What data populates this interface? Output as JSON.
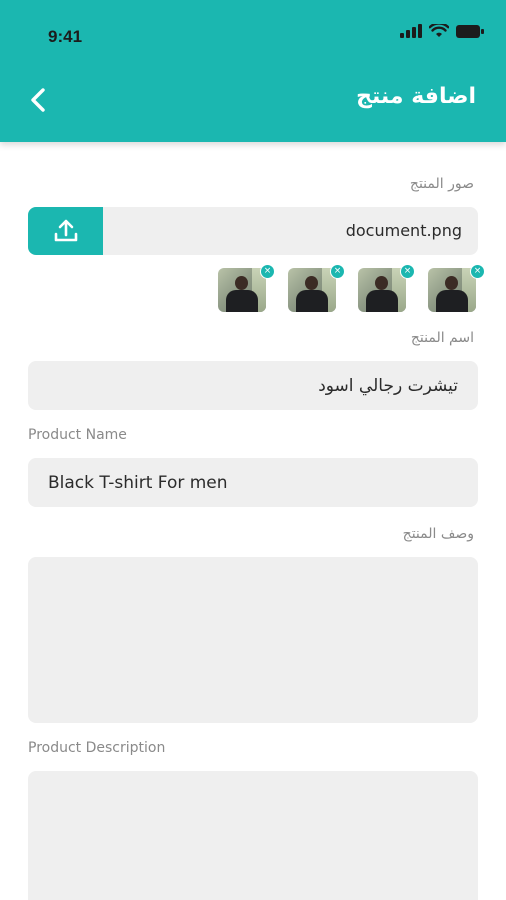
{
  "status_bar": {
    "time": "9:41"
  },
  "header": {
    "title": "اضافة منتج"
  },
  "images_section": {
    "label": "صور المنتج",
    "file_name": "document.png",
    "thumbnails": [
      {
        "remove_symbol": "×"
      },
      {
        "remove_symbol": "×"
      },
      {
        "remove_symbol": "×"
      },
      {
        "remove_symbol": "×"
      }
    ]
  },
  "name_ar": {
    "label": "اسم المنتج",
    "value": "تيشرت رجالي اسود"
  },
  "name_en": {
    "label": "Product Name",
    "value": "Black T-shirt For men"
  },
  "desc_ar": {
    "label": "وصف المنتج",
    "value": ""
  },
  "desc_en": {
    "label": "Product Description",
    "value": ""
  },
  "colors": {
    "accent": "#1bb7b0",
    "field_bg": "#efefef",
    "label": "#8a8a8a"
  },
  "icons": [
    "back-chevron-icon",
    "upload-icon",
    "signal-icon",
    "wifi-icon",
    "battery-icon",
    "close-icon"
  ]
}
